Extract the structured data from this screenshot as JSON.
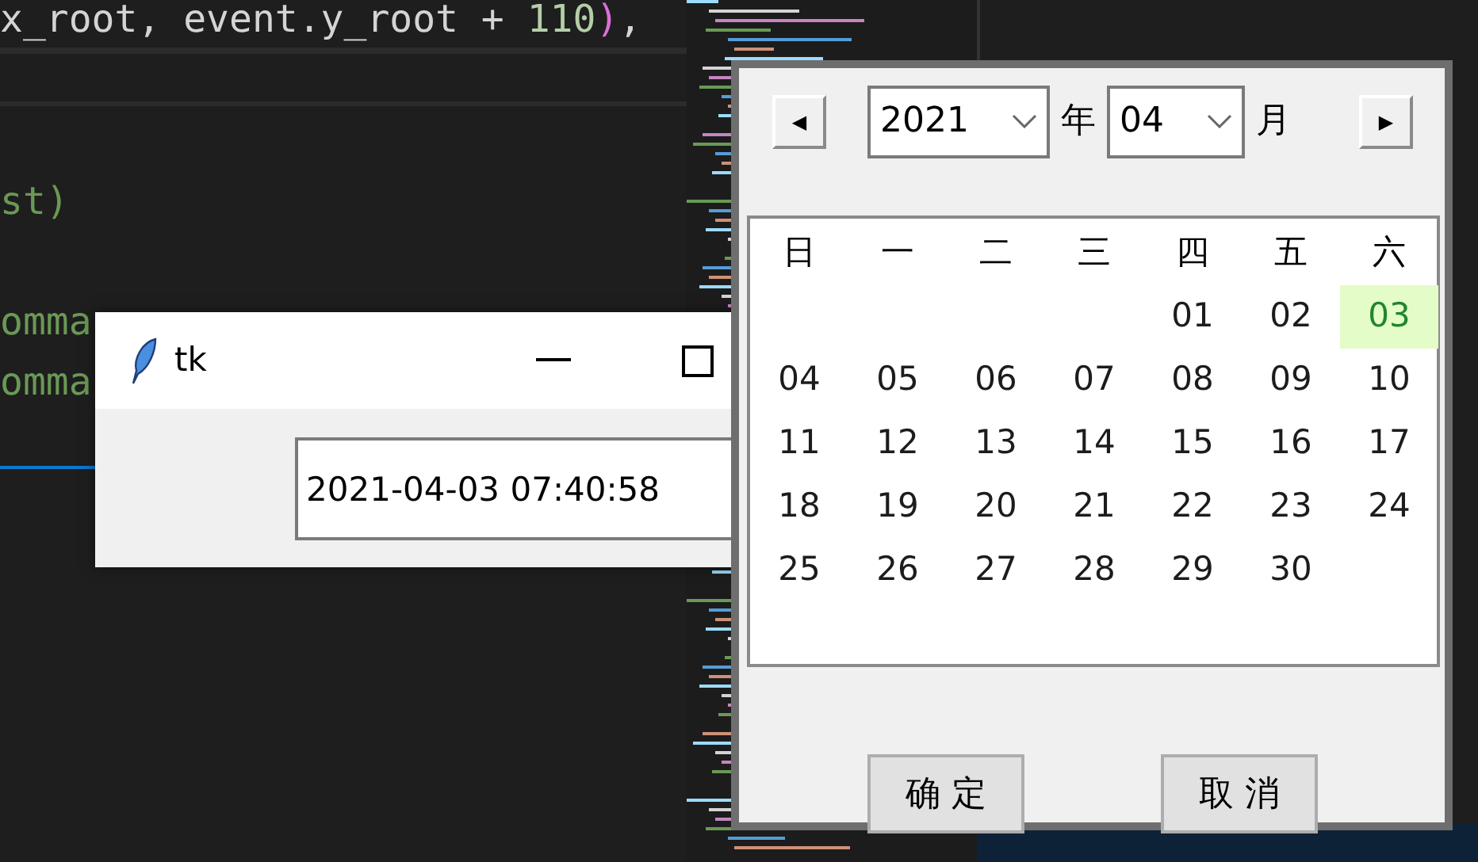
{
  "editor": {
    "code_lines": [
      {
        "segments": [
          {
            "text": "x_root, event.y_root + ",
            "kind": "plain"
          },
          {
            "text": "110",
            "kind": "number"
          },
          {
            "text": ")",
            "kind": "bracket"
          },
          {
            "text": ",",
            "kind": "plain"
          }
        ]
      },
      {
        "segments": [
          {
            "text": "st)",
            "kind": "green"
          }
        ]
      },
      {
        "segments": [
          {
            "text": "omma",
            "kind": "green"
          }
        ]
      },
      {
        "segments": [
          {
            "text": "omma",
            "kind": "green"
          }
        ]
      }
    ]
  },
  "tk_window": {
    "title": "tk",
    "entry_value": "2021-04-03 07:40:58"
  },
  "calendar": {
    "prev_symbol": "◀",
    "next_symbol": "▶",
    "year": "2021",
    "year_label": "年",
    "month": "04",
    "month_label": "月",
    "weekdays": [
      "日",
      "一",
      "二",
      "三",
      "四",
      "五",
      "六"
    ],
    "weeks": [
      [
        {
          "text": "01",
          "selected": false
        },
        {
          "text": "02",
          "selected": false
        },
        {
          "text": "03",
          "selected": true
        }
      ],
      [
        {
          "text": "04",
          "selected": false
        },
        {
          "text": "05",
          "selected": false
        },
        {
          "text": "06",
          "selected": false
        },
        {
          "text": "07",
          "selected": false
        },
        {
          "text": "08",
          "selected": false
        },
        {
          "text": "09",
          "selected": false
        },
        {
          "text": "10",
          "selected": false
        }
      ],
      [
        {
          "text": "11",
          "selected": false
        },
        {
          "text": "12",
          "selected": false
        },
        {
          "text": "13",
          "selected": false
        },
        {
          "text": "14",
          "selected": false
        },
        {
          "text": "15",
          "selected": false
        },
        {
          "text": "16",
          "selected": false
        },
        {
          "text": "17",
          "selected": false
        }
      ],
      [
        {
          "text": "18",
          "selected": false
        },
        {
          "text": "19",
          "selected": false
        },
        {
          "text": "20",
          "selected": false
        },
        {
          "text": "21",
          "selected": false
        },
        {
          "text": "22",
          "selected": false
        },
        {
          "text": "23",
          "selected": false
        },
        {
          "text": "24",
          "selected": false
        }
      ],
      [
        {
          "text": "25",
          "selected": false
        },
        {
          "text": "26",
          "selected": false
        },
        {
          "text": "27",
          "selected": false
        },
        {
          "text": "28",
          "selected": false
        },
        {
          "text": "29",
          "selected": false
        },
        {
          "text": "30",
          "selected": false
        }
      ]
    ],
    "buttons": [
      "确 定",
      "取 消"
    ]
  }
}
